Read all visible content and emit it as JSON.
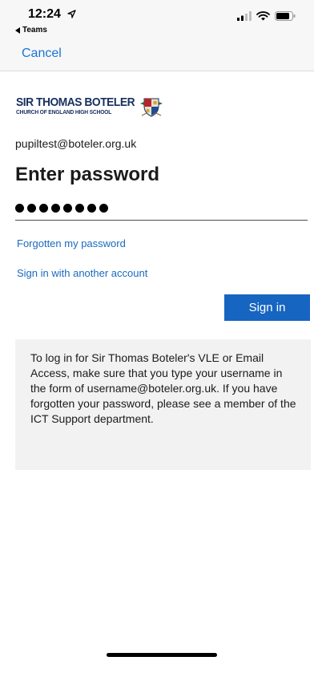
{
  "status_bar": {
    "time": "12:24",
    "back_app": "Teams"
  },
  "nav": {
    "cancel_label": "Cancel"
  },
  "logo": {
    "main": "SIR THOMAS BOTELER",
    "sub": "CHURCH OF ENGLAND HIGH SCHOOL"
  },
  "account": {
    "email": "pupiltest@boteler.org.uk"
  },
  "page": {
    "title": "Enter password"
  },
  "password": {
    "masked_length": 8
  },
  "links": {
    "forgot": "Forgotten my password",
    "other_account": "Sign in with another account"
  },
  "buttons": {
    "sign_in": "Sign in"
  },
  "info": {
    "text": "To log in for Sir Thomas Boteler's VLE or Email Access, make sure that you type your username in the form of username@boteler.org.uk. If you have forgotten your password, please see a member of the ICT Support department."
  },
  "colors": {
    "accent": "#1665c0",
    "link": "#1a6abf",
    "logo_navy": "#17305f",
    "info_bg": "#f2f2f2"
  }
}
